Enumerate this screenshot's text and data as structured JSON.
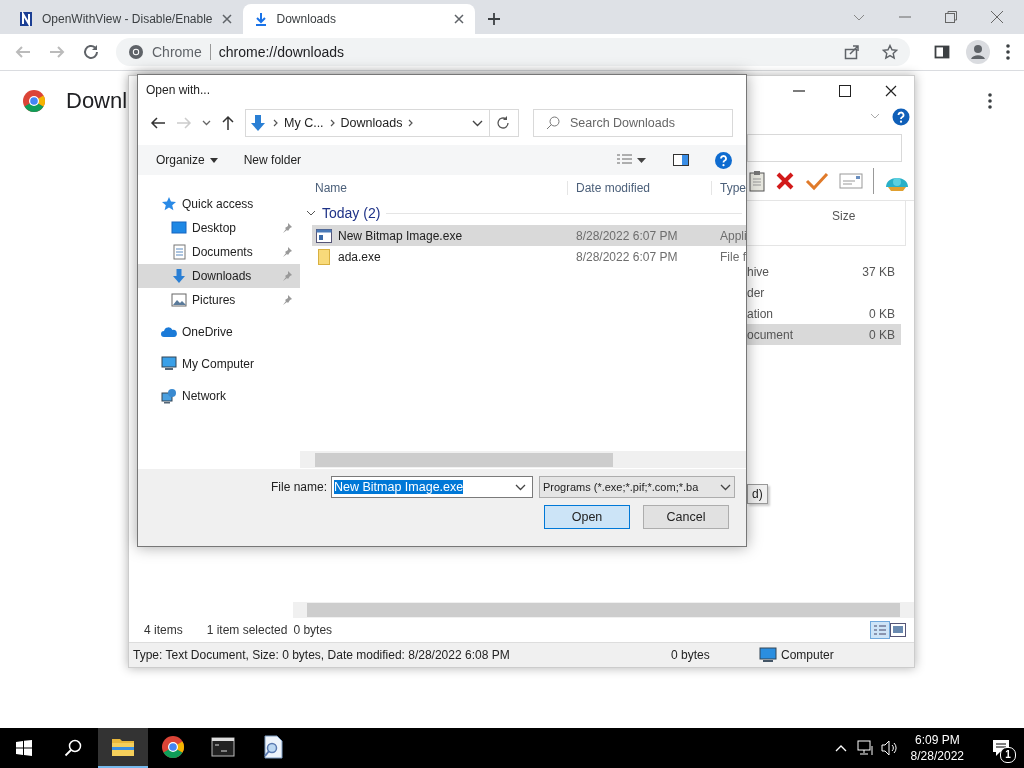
{
  "browser": {
    "tabs": [
      {
        "title": "OpenWithView - Disable/Enable",
        "selected": false
      },
      {
        "title": "Downloads",
        "selected": true
      }
    ],
    "omnibox": {
      "site": "Chrome",
      "url": "chrome://downloads"
    },
    "page": {
      "heading": "Downl"
    }
  },
  "back_window": {
    "columns": [
      {
        "label": "Size"
      }
    ],
    "rows": [
      {
        "column_1": "hive",
        "size": "37 KB",
        "selected": false
      },
      {
        "column_1": "der",
        "selected": false
      },
      {
        "column_1": "ation",
        "size": "0 KB",
        "selected": false
      },
      {
        "column_1": "ocument",
        "size": "0 KB",
        "selected": true
      }
    ],
    "button_label": "d)",
    "status": {
      "count": "4 items",
      "selection": "1 item selected",
      "selection_size": "0 bytes"
    },
    "status_bar": [
      "Type: Text Document, Size: 0 bytes, Date modified: 8/28/2022 6:08 PM",
      "0 bytes",
      "Computer"
    ]
  },
  "dialog": {
    "title": "Open with...",
    "breadcrumb": [
      "My C...",
      "Downloads"
    ],
    "search": {
      "placeholder": "Search Downloads"
    },
    "commands": [
      {
        "label": "Organize",
        "menu": true
      },
      {
        "label": "New folder",
        "menu": false
      }
    ],
    "nav": [
      {
        "label": "Quick access",
        "kind": "star",
        "pinned": false,
        "selected": false
      },
      {
        "label": "Desktop",
        "kind": "desktop",
        "pinned": true,
        "selected": false
      },
      {
        "label": "Documents",
        "kind": "documents",
        "pinned": true,
        "selected": false
      },
      {
        "label": "Downloads",
        "kind": "downloads",
        "pinned": true,
        "selected": true
      },
      {
        "label": "Pictures",
        "kind": "pictures",
        "pinned": true,
        "selected": false
      },
      {
        "label": "OneDrive",
        "kind": "cloud",
        "pinned": false,
        "selected": false
      },
      {
        "label": "My Computer",
        "kind": "computer",
        "pinned": false,
        "selected": false
      },
      {
        "label": "Network",
        "kind": "network",
        "pinned": false,
        "selected": false
      }
    ],
    "columns": [
      "Name",
      "Date modified",
      "Type"
    ],
    "group": "Today (2)",
    "files": [
      {
        "name": "New Bitmap Image.exe",
        "date": "8/28/2022 6:07 PM",
        "type": "Appli",
        "kind": "app",
        "selected": true
      },
      {
        "name": "ada.exe",
        "date": "8/28/2022 6:07 PM",
        "type": "File f",
        "kind": "folder",
        "selected": false
      }
    ],
    "file_name_label": "File name:",
    "file_name": "New Bitmap Image.exe",
    "file_type": "Programs (*.exe;*.pif;*.com;*.ba",
    "buttons": [
      {
        "label": "Open",
        "default": true
      },
      {
        "label": "Cancel",
        "default": false
      }
    ]
  },
  "taskbar": {
    "apps": [
      {
        "kind": "explorer",
        "selected": true
      },
      {
        "kind": "chrome",
        "selected": false
      },
      {
        "kind": "terminal",
        "selected": false
      },
      {
        "kind": "viewer",
        "selected": false
      }
    ],
    "time": "6:09 PM",
    "date": "8/28/2022",
    "notifications": "1"
  }
}
